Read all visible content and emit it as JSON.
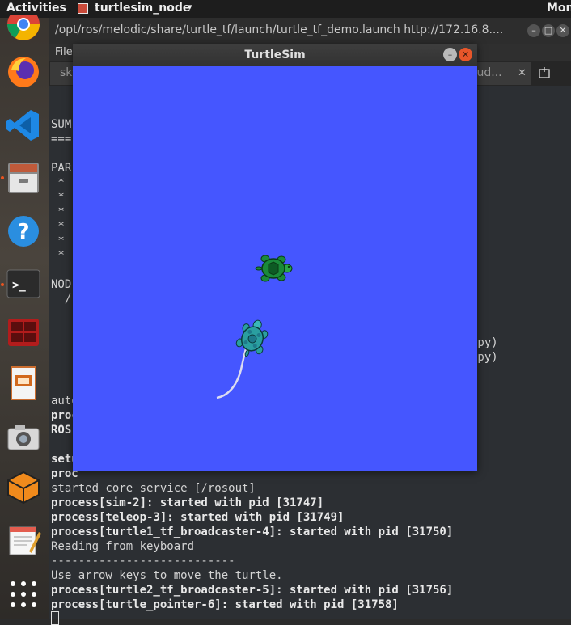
{
  "topbar": {
    "activities": "Activities",
    "app_name": "turtlesim_node",
    "app_menu_arrow": "▾",
    "clock": "Mon"
  },
  "dock": {
    "items": [
      {
        "name": "chrome-icon"
      },
      {
        "name": "firefox-icon"
      },
      {
        "name": "vscode-icon"
      },
      {
        "name": "files-icon"
      },
      {
        "name": "help-icon",
        "glyph": "?"
      },
      {
        "name": "terminal-icon",
        "glyph": ">_"
      },
      {
        "name": "terminator-icon"
      },
      {
        "name": "impress-icon"
      },
      {
        "name": "camera-icon"
      },
      {
        "name": "virtualbox-icon"
      },
      {
        "name": "text-editor-icon"
      },
      {
        "name": "show-apps-icon"
      }
    ]
  },
  "terminal": {
    "title": "/opt/ros/melodic/share/turtle_tf/launch/turtle_tf_demo.launch http://172.16.8....",
    "menu_first": "File",
    "tab_left_label": "sky",
    "tab_right_label": "tud...",
    "tab_close": "✕",
    "minimize_glyph": "–",
    "maximize_glyph": "□",
    "close_glyph": "✕",
    "lines": [
      {
        "text": "SUM",
        "bold": false
      },
      {
        "text": "===",
        "bold": false
      },
      {
        "text": "PAR",
        "bold": false
      },
      {
        "text": " *",
        "bold": false
      },
      {
        "text": " *",
        "bold": false
      },
      {
        "text": " *",
        "bold": false
      },
      {
        "text": " *",
        "bold": false
      },
      {
        "text": " *",
        "bold": false
      },
      {
        "text": " *",
        "bold": false
      },
      {
        "text": "NOD",
        "bold": false
      },
      {
        "text": "  /",
        "bold": false
      },
      {
        "text": "auto",
        "bold": false
      },
      {
        "text": "proc",
        "bold": true
      },
      {
        "text": "ROS",
        "bold": true
      },
      {
        "text": "setu",
        "bold": true
      },
      {
        "text": "proc",
        "bold": true
      },
      {
        "text": "started core service [/rosout]",
        "bold": false
      },
      {
        "text": "process[sim-2]: started with pid [31747]",
        "bold": true
      },
      {
        "text": "process[teleop-3]: started with pid [31749]",
        "bold": true
      },
      {
        "text": "process[turtle1_tf_broadcaster-4]: started with pid [31750]",
        "bold": true
      },
      {
        "text": "Reading from keyboard",
        "bold": false
      },
      {
        "text": "---------------------------",
        "bold": false
      },
      {
        "text": "Use arrow keys to move the turtle.",
        "bold": false
      },
      {
        "text": "process[turtle2_tf_broadcaster-5]: started with pid [31756]",
        "bold": true
      },
      {
        "text": "process[turtle_pointer-6]: started with pid [31758]",
        "bold": true
      }
    ],
    "py_lines": [
      ".py)",
      ".py)"
    ]
  },
  "turtlesim": {
    "title": "TurtleSim",
    "minimize_glyph": "–",
    "close_glyph": "✕",
    "background_color": "#4556ff",
    "turtle1_color": "#1a8a3a",
    "turtle2_color": "#2a9fa0",
    "trail_color": "#dcdcf0"
  }
}
